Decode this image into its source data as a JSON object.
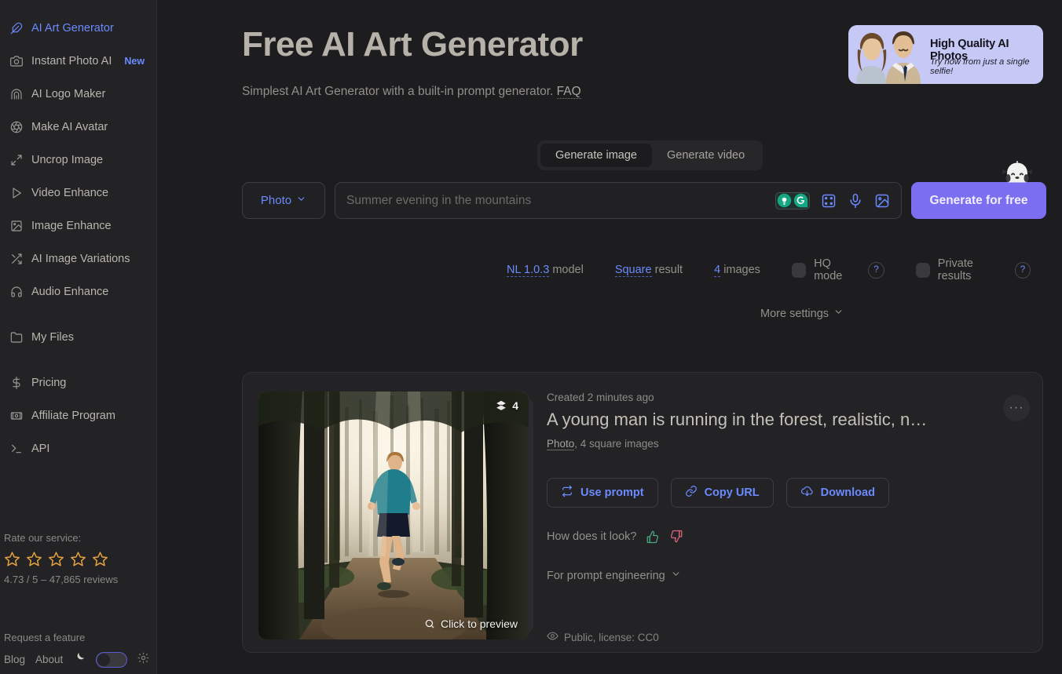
{
  "colors": {
    "bg": "#1d1d1f",
    "sidebar_bg": "#232326",
    "accent_blue": "#6b8afd",
    "accent_purple": "#7c6ef0",
    "star": "#e8a33d",
    "text": "#b9b5ad",
    "muted": "#8a8884"
  },
  "sidebar": {
    "items": [
      {
        "label": "AI Art Generator",
        "icon": "feather-icon",
        "active": true,
        "badge": ""
      },
      {
        "label": "Instant Photo AI",
        "icon": "camera-icon",
        "active": false,
        "badge": "New"
      },
      {
        "label": "AI Logo Maker",
        "icon": "arch-icon",
        "active": false,
        "badge": ""
      },
      {
        "label": "Make AI Avatar",
        "icon": "aperture-icon",
        "active": false,
        "badge": ""
      },
      {
        "label": "Uncrop Image",
        "icon": "expand-arrows-icon",
        "active": false,
        "badge": ""
      },
      {
        "label": "Video Enhance",
        "icon": "play-triangle-icon",
        "active": false,
        "badge": ""
      },
      {
        "label": "Image Enhance",
        "icon": "picture-icon",
        "active": false,
        "badge": ""
      },
      {
        "label": "AI Image Variations",
        "icon": "shuffle-icon",
        "active": false,
        "badge": ""
      },
      {
        "label": "Audio Enhance",
        "icon": "headphones-icon",
        "active": false,
        "badge": ""
      }
    ],
    "items2": [
      {
        "label": "My Files",
        "icon": "folder-icon"
      }
    ],
    "items3": [
      {
        "label": "Pricing",
        "icon": "dollar-icon"
      },
      {
        "label": "Affiliate Program",
        "icon": "banknote-icon"
      },
      {
        "label": "API",
        "icon": "terminal-icon"
      }
    ],
    "rating": {
      "label": "Rate our service:",
      "stars": 5,
      "summary": "4.73 / 5 – 47,865 reviews"
    },
    "request_feature": "Request a feature",
    "footer_links": [
      "Blog",
      "About"
    ],
    "theme": {
      "moon_icon": "moon-icon",
      "sun_icon": "sun-icon",
      "state": "dark"
    }
  },
  "header": {
    "title": "Free AI Art Generator",
    "subtitle": "Simplest AI Art Generator with a built-in prompt generator.",
    "faq_label": "FAQ"
  },
  "promo": {
    "headline": "High Quality AI Photos",
    "subline": "Try now from just a single selfie!"
  },
  "tabs": [
    {
      "label": "Generate image",
      "active": true
    },
    {
      "label": "Generate video",
      "active": false
    }
  ],
  "prompt_bar": {
    "type_label": "Photo",
    "placeholder": "Summer evening in the mountains",
    "value": "",
    "tools": [
      "grammarly-icon",
      "dice-icon",
      "microphone-icon",
      "image-upload-icon"
    ],
    "generate_label": "Generate for free",
    "mascot": "ghost-mascot-icon"
  },
  "settings": {
    "model_value": "NL 1.0.3",
    "model_label": "model",
    "result_value": "Square",
    "result_label": "result",
    "images_value": "4",
    "images_label": "images",
    "hq_label": "HQ mode",
    "hq_checked": false,
    "private_label": "Private results",
    "private_checked": false,
    "help_glyph": "?",
    "more_settings": "More settings"
  },
  "result": {
    "created": "Created 2 minutes ago",
    "prompt": "A young man is running in the forest, realistic, n…",
    "meta_link": "Photo",
    "meta_rest": ", 4 square images",
    "image_count": "4",
    "preview_label": "Click to preview",
    "actions": [
      {
        "label": "Use prompt",
        "icon": "refresh-icon"
      },
      {
        "label": "Copy URL",
        "icon": "link-icon"
      },
      {
        "label": "Download",
        "icon": "download-cloud-icon"
      }
    ],
    "feedback_label": "How does it look?",
    "thumbs_up_icon": "thumbs-up-icon",
    "thumbs_down_icon": "thumbs-down-icon",
    "prompt_engineering": "For prompt engineering",
    "license": "Public, license: CC0",
    "menu_glyph": "•••"
  }
}
